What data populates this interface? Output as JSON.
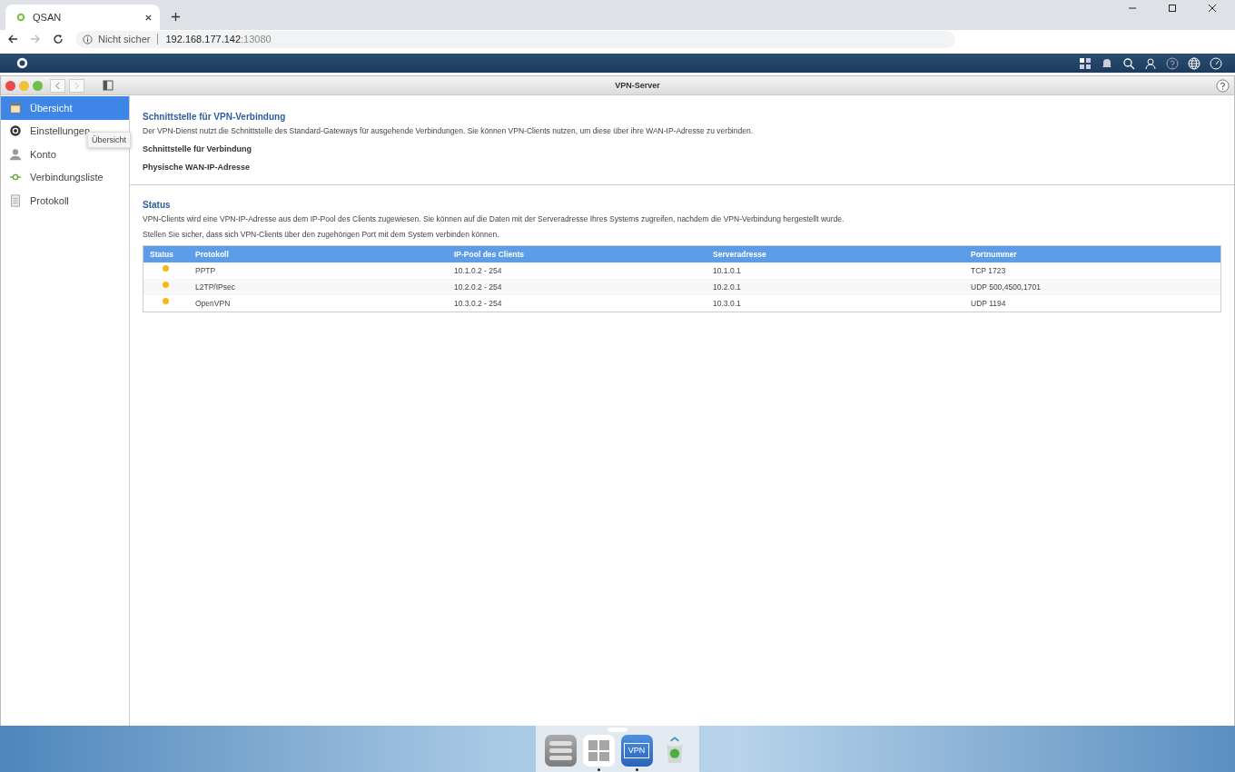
{
  "browser": {
    "tab_title": "QSAN",
    "security": "Nicht sicher",
    "url_host": "192.168.177.142",
    "url_port": ":13080"
  },
  "window": {
    "title": "VPN-Server"
  },
  "sidebar": {
    "items": [
      {
        "label": "Übersicht",
        "kind": "overview",
        "selected": true
      },
      {
        "label": "Einstellungen",
        "kind": "settings",
        "selected": false
      },
      {
        "label": "Konto",
        "kind": "account",
        "selected": false
      },
      {
        "label": "Verbindungsliste",
        "kind": "connections",
        "selected": false
      },
      {
        "label": "Protokoll",
        "kind": "log",
        "selected": false
      }
    ],
    "tooltip": "Übersicht"
  },
  "interface_section": {
    "title": "Schnittstelle für VPN-Verbindung",
    "description": "Der VPN-Dienst nutzt die Schnittstelle des Standard-Gateways für ausgehende Verbindungen. Sie können VPN-Clients nutzen, um diese über ihre WAN-IP-Adresse zu verbinden.",
    "fields": [
      "Schnittstelle für Verbindung",
      "Physische WAN-IP-Adresse"
    ]
  },
  "status_section": {
    "title": "Status",
    "descriptions": [
      "VPN-Clients wird eine VPN-IP-Adresse aus dem IP-Pool des Clients zugewiesen. Sie können auf die Daten mit der Serveradresse Ihres Systems zugreifen, nachdem die VPN-Verbindung hergestellt wurde.",
      "Stellen Sie sicher, dass sich VPN-Clients über den zugehörigen Port mit dem System verbinden können."
    ],
    "table": {
      "columns": [
        "Status",
        "Protokoll",
        "IP-Pool des Clients",
        "Serveradresse",
        "Portnummer"
      ],
      "rows": [
        {
          "color": "#f5b81c",
          "protocol": "PPTP",
          "pool": "10.1.0.2 - 254",
          "server": "10.1.0.1",
          "port": "TCP 1723"
        },
        {
          "color": "#f5b81c",
          "protocol": "L2TP/IPsec",
          "pool": "10.2.0.2 - 254",
          "server": "10.2.0.1",
          "port": "UDP 500,4500,1701"
        },
        {
          "color": "#f5b81c",
          "protocol": "OpenVPN",
          "pool": "10.3.0.2 - 254",
          "server": "10.3.0.1",
          "port": "UDP 1194"
        }
      ]
    }
  },
  "dock": [
    {
      "kind": "storage",
      "running": false
    },
    {
      "kind": "apps",
      "running": true
    },
    {
      "kind": "vpn",
      "label": "VPN",
      "running": true
    },
    {
      "kind": "recycle",
      "running": false
    }
  ]
}
